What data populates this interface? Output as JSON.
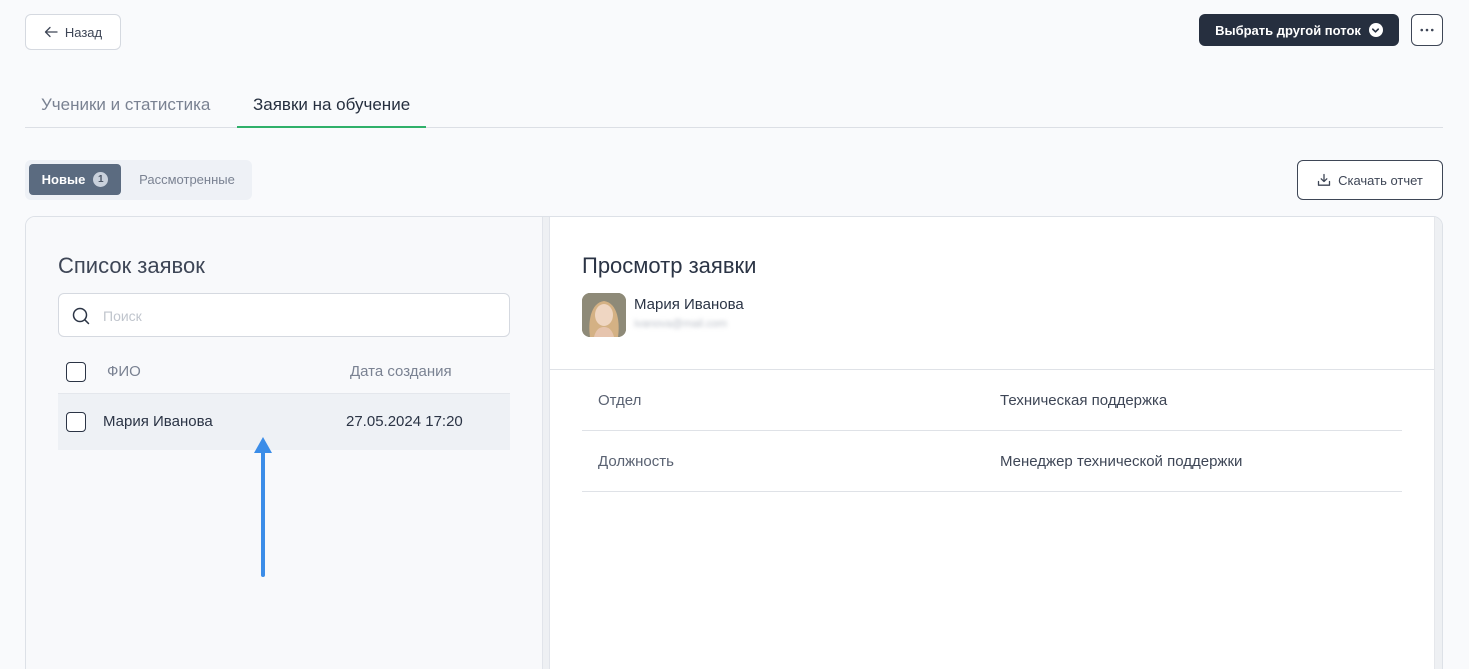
{
  "header": {
    "back_label": "Назад",
    "choose_flow_label": "Выбрать другой поток"
  },
  "tabs": [
    {
      "label": "Ученики и статистика",
      "active": false
    },
    {
      "label": "Заявки на обучение",
      "active": true
    }
  ],
  "filter": {
    "new_label": "Новые",
    "new_count": "1",
    "reviewed_label": "Рассмотренные",
    "download_label": "Скачать отчет"
  },
  "list": {
    "title": "Список заявок",
    "search_placeholder": "Поиск",
    "columns": {
      "name": "ФИО",
      "date": "Дата создания"
    },
    "rows": [
      {
        "name": "Мария Иванова",
        "date": "27.05.2024 17:20"
      }
    ]
  },
  "view": {
    "title": "Просмотр заявки",
    "user_name": "Мария Иванова",
    "user_email": "ivanova@mail.com",
    "fields": [
      {
        "label": "Отдел",
        "value": "Техническая поддержка"
      },
      {
        "label": "Должность",
        "value": "Менеджер технической поддержки"
      }
    ]
  },
  "colors": {
    "accent": "#2fb06a",
    "dark_button": "#262f3f",
    "segment_active": "#5b6b80",
    "annotation_arrow": "#3b8de8"
  }
}
